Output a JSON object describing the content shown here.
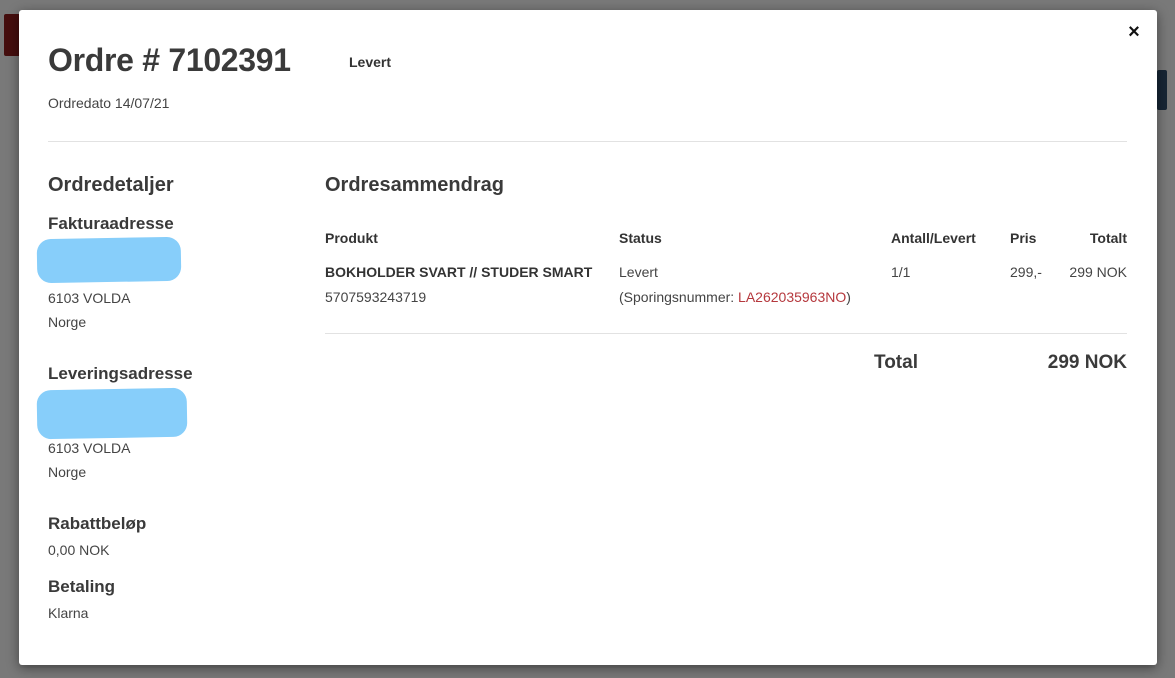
{
  "order": {
    "title": "Ordre # 7102391",
    "status": "Levert",
    "date": "Ordredato 14/07/21"
  },
  "close_label": "×",
  "details": {
    "title": "Ordredetaljer",
    "billing": {
      "heading": "Fakturaadresse",
      "postal": "6103 VOLDA",
      "country": "Norge"
    },
    "shipping": {
      "heading": "Leveringsadresse",
      "postal": "6103 VOLDA",
      "country": "Norge"
    },
    "discount": {
      "heading": "Rabattbeløp",
      "value": "0,00 NOK"
    },
    "payment": {
      "heading": "Betaling",
      "value": "Klarna"
    }
  },
  "summary": {
    "title": "Ordresammendrag",
    "columns": {
      "product": "Produkt",
      "status": "Status",
      "qty": "Antall/Levert",
      "price": "Pris",
      "total": "Totalt"
    },
    "rows": [
      {
        "name": "BOKHOLDER SVART // STUDER SMART",
        "sku": "5707593243719",
        "status": "Levert",
        "tracking_prefix": "(Sporingsnummer: ",
        "tracking_number": "LA262035963NO",
        "tracking_suffix": ")",
        "qty": "1/1",
        "price": "299,-",
        "total": "299 NOK"
      }
    ],
    "total_label": "Total",
    "total_value": "299 NOK"
  },
  "colors": {
    "link": "#b5383d",
    "redaction": "#87cefa"
  }
}
